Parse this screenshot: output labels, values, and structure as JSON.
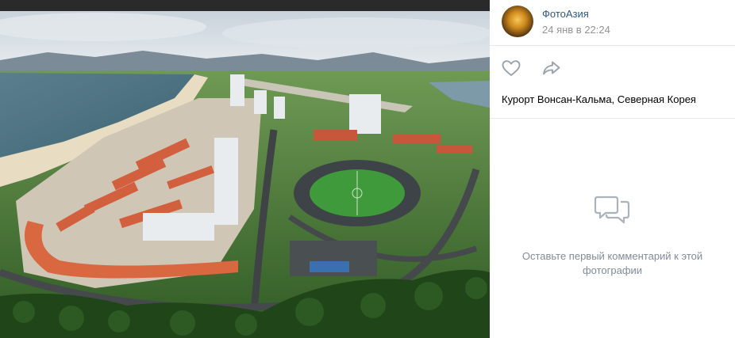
{
  "photo": {
    "description_icon": "photo-image"
  },
  "post": {
    "author": "ФотоАзия",
    "date": "24 янв в 22:24",
    "caption": "Курорт Вонсан-Кальма, Северная Корея"
  },
  "actions": {
    "like_icon": "heart-icon",
    "share_icon": "share-arrow-icon"
  },
  "comments": {
    "empty_text": "Оставьте первый комментарий к этой фотографии",
    "icon": "comments-icon"
  },
  "colors": {
    "link": "#2a5885",
    "muted": "#939393",
    "hint": "#818c99",
    "icon": "#99a2ad",
    "divider": "#e7e8ec"
  }
}
